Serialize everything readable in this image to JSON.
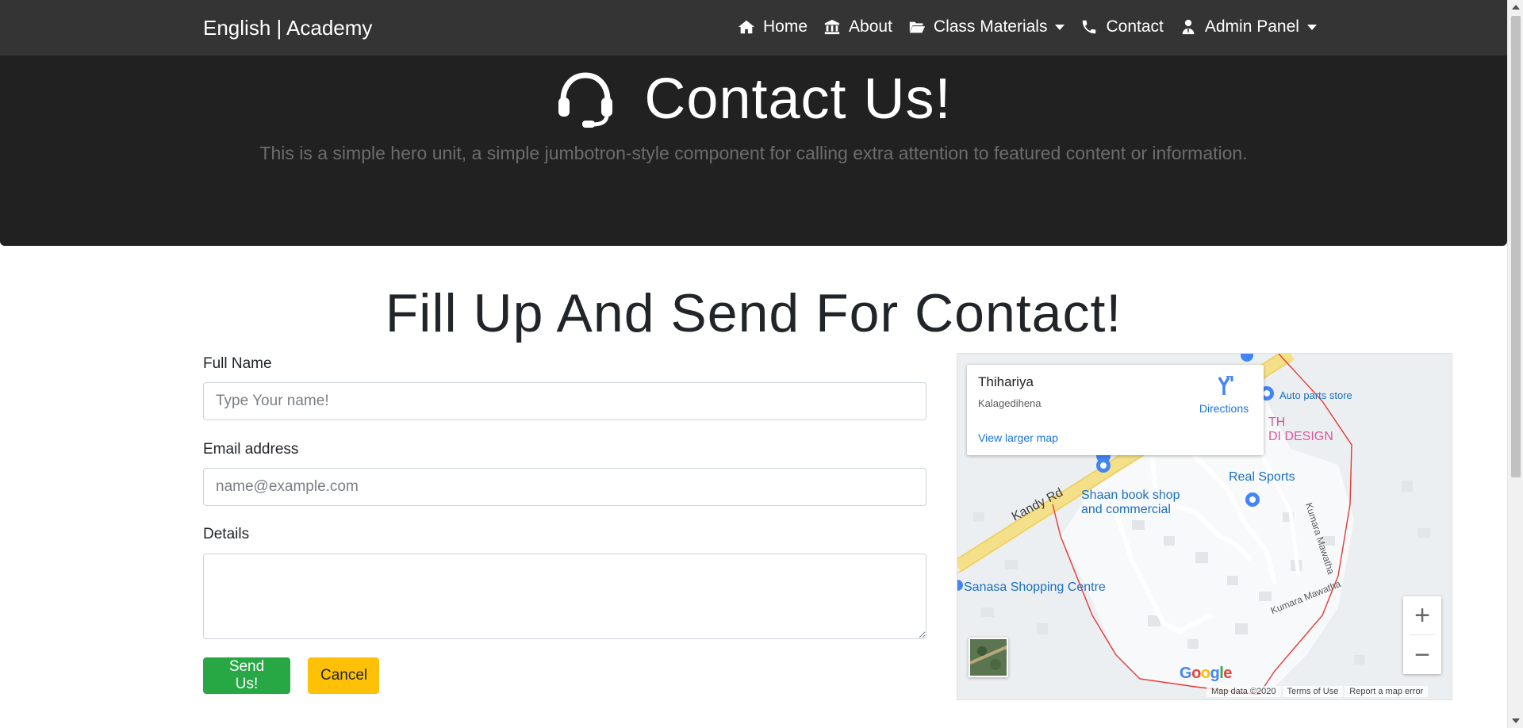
{
  "navbar": {
    "brand": "English | Academy",
    "items": [
      {
        "label": "Home",
        "icon": "home-icon"
      },
      {
        "label": "About",
        "icon": "bank-icon"
      },
      {
        "label": "Class Materials",
        "icon": "folder-open-icon",
        "dropdown": true
      },
      {
        "label": "Contact",
        "icon": "phone-icon"
      },
      {
        "label": "Admin Panel",
        "icon": "user-tie-icon",
        "dropdown": true
      }
    ]
  },
  "hero": {
    "title": "Contact Us!",
    "icon": "headset-icon",
    "lead": "This is a simple hero unit, a simple jumbotron-style component for calling extra attention to featured content or information."
  },
  "section": {
    "title": "Fill Up And Send For Contact!"
  },
  "form": {
    "full_name_label": "Full Name",
    "full_name_placeholder": "Type Your name!",
    "email_label": "Email address",
    "email_placeholder": "name@example.com",
    "details_label": "Details",
    "details_value": "",
    "send_label": "Send Us!",
    "cancel_label": "Cancel"
  },
  "map": {
    "place_name": "Thihariya",
    "place_area": "Kalagedihena",
    "directions_label": "Directions",
    "larger_map_label": "View larger map",
    "labels": {
      "auto_parts": "Auto parts store",
      "design_1": "TH",
      "design_2": "DI DESIGN",
      "real_sports": "Real Sports",
      "book_shop_1": "Shaan book shop",
      "book_shop_2": "and commercial",
      "shopping_centre": "Sanasa Shopping Centre",
      "kandy_rd": "Kandy Rd",
      "kumara_mawatha_1": "Kumara Mawatha",
      "kumara_mawatha_2": "Kumara Mawatha"
    },
    "zoom_in": "+",
    "zoom_out": "−",
    "google_logo": "Google",
    "map_data": "Map data ©2020",
    "terms": "Terms of Use",
    "report": "Report a map error"
  },
  "colors": {
    "navbar_bg": "#343434",
    "hero_bg": "#212121",
    "success": "#28a745",
    "warning": "#ffc107",
    "map_link": "#1a73e8"
  }
}
